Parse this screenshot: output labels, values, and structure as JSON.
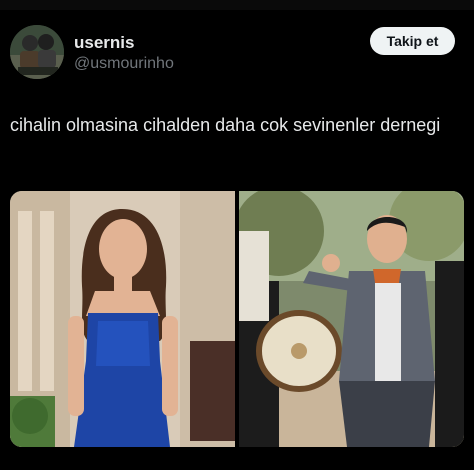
{
  "user": {
    "display_name": "usernis",
    "handle": "@usmourinho"
  },
  "follow_button": {
    "label": "Takip et"
  },
  "tweet": {
    "text": "cihalin olmasina cihalden daha cok sevinenler dernegi"
  },
  "colors": {
    "background": "#000000",
    "text_primary": "#e7e9ea",
    "text_secondary": "#71767b",
    "follow_button_bg": "#eff3f4",
    "follow_button_text": "#0f1419"
  }
}
